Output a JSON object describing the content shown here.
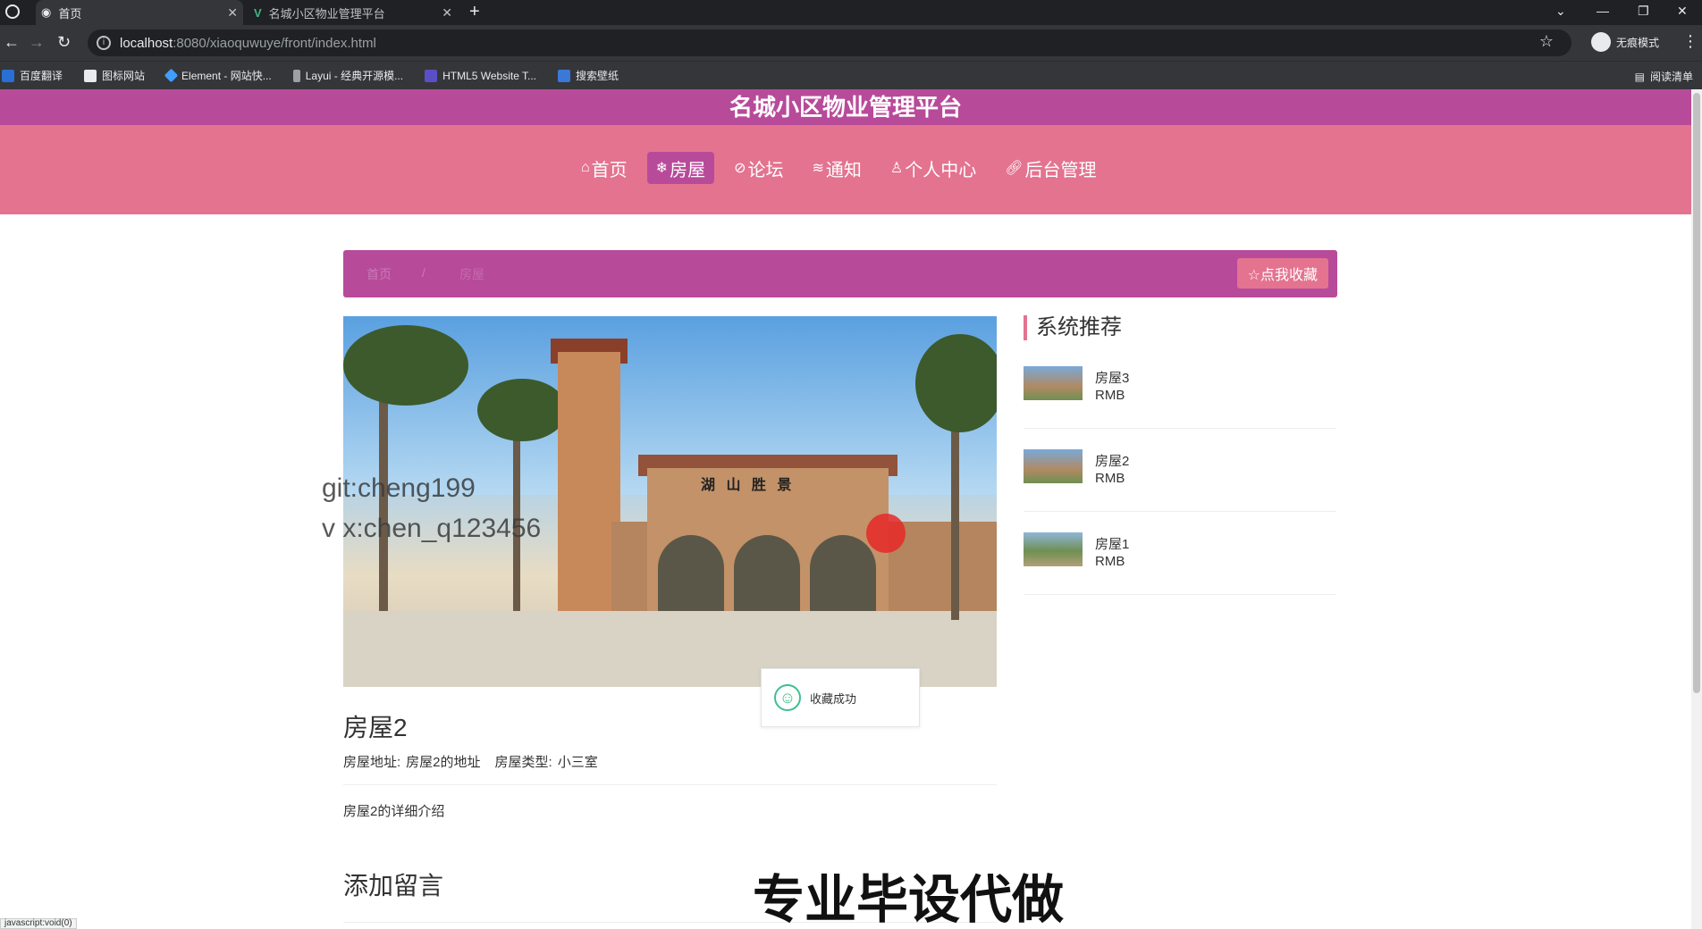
{
  "browser": {
    "tabs": [
      {
        "title": "首页",
        "active": true
      },
      {
        "title": "名城小区物业管理平台",
        "active": false
      }
    ],
    "url_host": "localhost",
    "url_path": ":8080/xiaoquwuye/front/index.html",
    "incognito_label": "无痕模式",
    "bookmarks": [
      "百度翻译",
      "图标网站",
      "Element - 网站快...",
      "Layui - 经典开源模...",
      "HTML5 Website T...",
      "搜索壁纸"
    ],
    "reading_list_label": "阅读清单",
    "status_text": "javascript:void(0)"
  },
  "site": {
    "title": "名城小区物业管理平台",
    "nav": [
      {
        "label": "首页",
        "icon": "home-icon",
        "active": false
      },
      {
        "label": "房屋",
        "icon": "snowflake-icon",
        "active": true
      },
      {
        "label": "论坛",
        "icon": "forum-icon",
        "active": false
      },
      {
        "label": "通知",
        "icon": "notice-icon",
        "active": false
      },
      {
        "label": "个人中心",
        "icon": "user-icon",
        "active": false
      },
      {
        "label": "后台管理",
        "icon": "link-icon",
        "active": false
      }
    ]
  },
  "breadcrumb": {
    "home": "首页",
    "separator": "/",
    "current": "房屋",
    "favorite_button": "☆点我收藏"
  },
  "house": {
    "image_sign": "湖 山 胜 景",
    "title": "房屋2",
    "address_label": "房屋地址:",
    "address_value": "房屋2的地址",
    "type_label": "房屋类型:",
    "type_value": "小三室",
    "detail": "房屋2的详细介绍"
  },
  "toast": {
    "message": "收藏成功"
  },
  "comment": {
    "section_title": "添加留言"
  },
  "sidebar": {
    "title": "系统推荐",
    "items": [
      {
        "name": "房屋3",
        "price": "RMB"
      },
      {
        "name": "房屋2",
        "price": "RMB"
      },
      {
        "name": "房屋1",
        "price": "RMB"
      }
    ]
  },
  "overlay": {
    "watermark_line1": "git:cheng199",
    "watermark_line2": "v x:chen_q123456",
    "big_watermark": "专业毕设代做"
  },
  "colors": {
    "header_bg": "#b84a9a",
    "nav_bg": "#e47390",
    "active_nav_bg": "#b84a9a",
    "toast_icon": "#3fbf8f"
  }
}
